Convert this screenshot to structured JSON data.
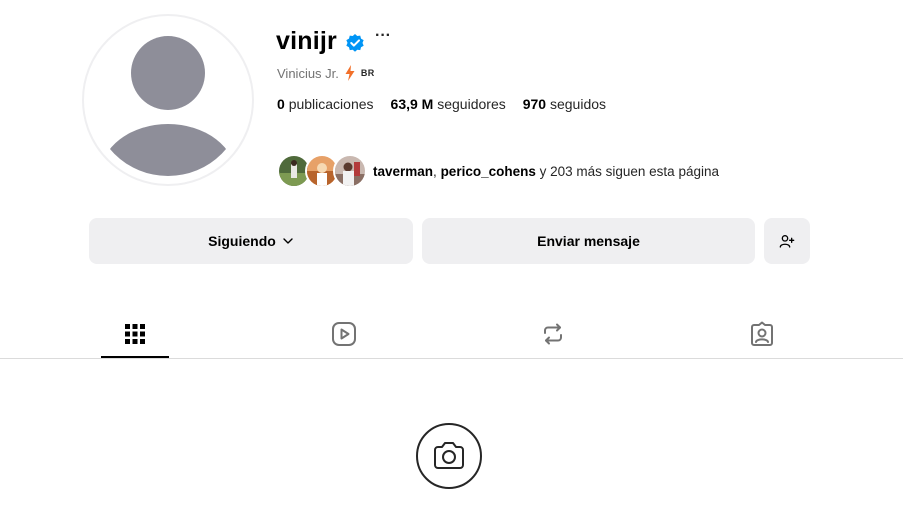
{
  "profile": {
    "username": "vinijr",
    "more_label": "···",
    "full_name": "Vinicius Jr.",
    "country_code": "BR",
    "stats": {
      "posts_value": "0",
      "posts_label": "publicaciones",
      "followers_value": "63,9 M",
      "followers_label": "seguidores",
      "following_value": "970",
      "following_label": "seguidos"
    },
    "followed_by": {
      "user1": "taverman",
      "separator": ", ",
      "user2": "perico_cohens",
      "rest": " y 203 más siguen esta página"
    }
  },
  "actions": {
    "following_label": "Siguiendo",
    "message_label": "Enviar mensaje"
  },
  "tabs": [
    {
      "name": "posts-grid-icon",
      "active": true
    },
    {
      "name": "reels-icon",
      "active": false
    },
    {
      "name": "reposts-icon",
      "active": false
    },
    {
      "name": "tagged-icon",
      "active": false
    }
  ],
  "colors": {
    "verified": "#0095f6",
    "button_bg": "#efeff1",
    "avatar_placeholder": "#8e8e99"
  }
}
